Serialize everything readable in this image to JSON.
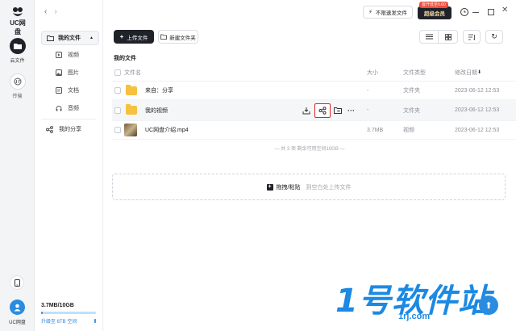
{
  "app": {
    "logo_text": "UC网盘"
  },
  "rail": {
    "items": [
      {
        "label": "云文件",
        "icon": "cloud-folder-icon"
      },
      {
        "label": "传输",
        "icon": "transfer-icon"
      }
    ]
  },
  "sidebar": {
    "my_files": "我的文件",
    "categories": [
      {
        "label": "视频",
        "icon": "video-icon"
      },
      {
        "label": "图片",
        "icon": "image-icon"
      },
      {
        "label": "文档",
        "icon": "document-icon"
      },
      {
        "label": "音频",
        "icon": "headphones-icon"
      }
    ],
    "my_share": "我的分享",
    "storage_text": "3.7MB/10GB",
    "storage_fraction": 0.0004,
    "upgrade_text": "升级至 6TB 空间"
  },
  "topbar": {
    "unlimited_label": "不限速发文件",
    "vip_badge": "首开低至0.60",
    "vip_label": "超级会员"
  },
  "toolbar": {
    "upload_label": "上传文件",
    "new_folder_label": "新建文件夹"
  },
  "breadcrumb": "我的文件",
  "table": {
    "headers": {
      "name": "文件名",
      "size": "大小",
      "type": "文件类型",
      "modified": "修改日期"
    },
    "rows": [
      {
        "name": "来自：分享",
        "size": "-",
        "type": "文件夹",
        "modified": "2023-06-12 12:53",
        "kind": "folder"
      },
      {
        "name": "我的视频",
        "size": "-",
        "type": "文件夹",
        "modified": "2023-06-12 12:53",
        "kind": "folder"
      },
      {
        "name": "UC网盘介绍.mp4",
        "size": "3.7MB",
        "type": "视频",
        "modified": "2023-06-12 12:53",
        "kind": "video"
      }
    ],
    "summary": "— 共 3 项 剩余可用空间10GB —"
  },
  "dropzone": {
    "title": "拖拽/粘贴",
    "hint": "到空白处上传文件"
  },
  "watermark": {
    "text": "1号软件站",
    "sub": "1rj.com"
  },
  "colors": {
    "accent": "#1f2329",
    "share_highlight": "#e02020",
    "vip_bg": "#1f2329",
    "vip_badge": "#f04b3a",
    "storage_bar": "#bfe0fb"
  }
}
